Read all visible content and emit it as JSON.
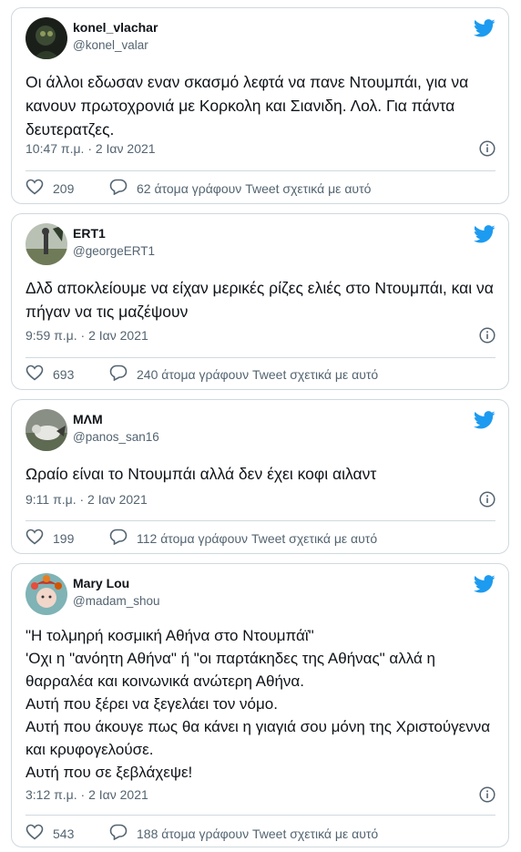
{
  "tweets": [
    {
      "name": "konel_vlachar",
      "handle": "@konel_valar",
      "text": "Οι άλλοι εδωσαν εναν σκασμό λεφτά να πανε Ντουμπάι, για να κανουν πρωτοχρονιά με Κορκολη και Σιανιδη. Λολ. Για πάντα δευτερατζες.",
      "time": "10:47 π.μ. · 2 Ιαν 2021",
      "likes": "209",
      "talking": "62 άτομα γράφουν Tweet σχετικά με αυτό"
    },
    {
      "name": "ERT1",
      "handle": "@georgeERT1",
      "text": "Δλδ αποκλείουμε να είχαν μερικές ρίζες ελιές στο Ντουμπάι, και να πήγαν να τις μαζέψουν",
      "time": "9:59 π.μ. · 2 Ιαν 2021",
      "likes": "693",
      "talking": "240 άτομα γράφουν Tweet σχετικά με αυτό"
    },
    {
      "name": "ΜΛΜ",
      "handle": "@panos_san16",
      "text": "Ωραίο είναι το Ντουμπάι αλλά δεν έχει κοφι αιλαντ",
      "time": "9:11 π.μ. · 2 Ιαν 2021",
      "likes": "199",
      "talking": "112 άτομα γράφουν Tweet σχετικά με αυτό"
    },
    {
      "name": "Mary Lou",
      "handle": "@madam_shou",
      "text": "\"Η τολμηρή κοσμική Αθήνα στο Ντουμπάϊ\"\n'Οχι η \"ανόητη Αθήνα\" ή \"οι παρτάκηδες της Αθήνας\" αλλά η θαρραλέα και κοινωνικά ανώτερη Αθήνα.\nΑυτή που ξέρει να ξεγελάει τον νόμο.\nΑυτή που άκουγε πως θα κάνει η γιαγιά σου μόνη της Χριστούγεννα και κρυφογελούσε.\nΑυτή που σε ξεβλάχεψε!",
      "time": "3:12 π.μ. · 2 Ιαν 2021",
      "likes": "543",
      "talking": "188 άτομα γράφουν Tweet σχετικά με αυτό"
    }
  ],
  "icons": {
    "bird": "twitter-bird-icon",
    "info": "info-icon",
    "like": "heart-icon",
    "reply": "speech-bubble-icon"
  },
  "colors": {
    "brand": "#1d9bf0",
    "text": "#0f1419",
    "secondary": "#536471",
    "border": "#cfd9de"
  }
}
